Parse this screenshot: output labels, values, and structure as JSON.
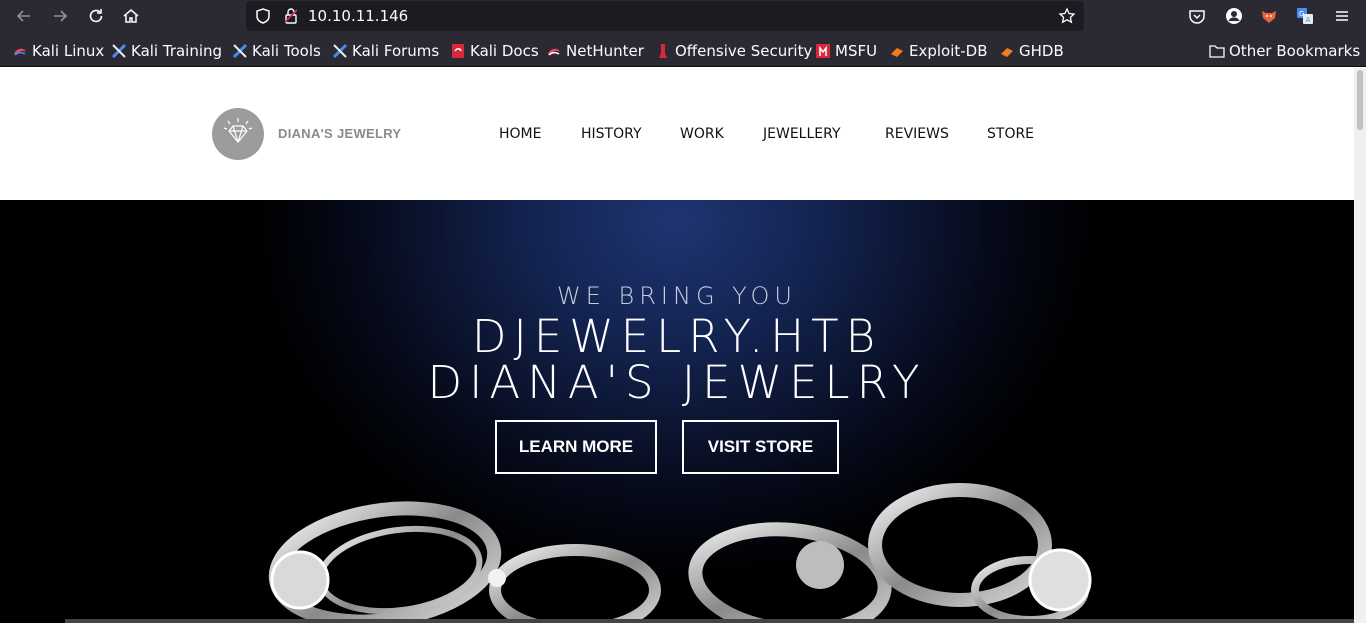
{
  "browser": {
    "url": "10.10.11.146",
    "bookmarks": [
      {
        "label": "Kali Linux",
        "icon": "kali-icon"
      },
      {
        "label": "Kali Training",
        "icon": "kali-training-icon"
      },
      {
        "label": "Kali Tools",
        "icon": "kali-tools-icon"
      },
      {
        "label": "Kali Forums",
        "icon": "kali-forums-icon"
      },
      {
        "label": "Kali Docs",
        "icon": "kali-docs-icon"
      },
      {
        "label": "NetHunter",
        "icon": "nethunter-icon"
      },
      {
        "label": "Offensive Security",
        "icon": "offsec-icon"
      },
      {
        "label": "MSFU",
        "icon": "msfu-icon"
      },
      {
        "label": "Exploit-DB",
        "icon": "exploitdb-icon"
      },
      {
        "label": "GHDB",
        "icon": "ghdb-icon"
      }
    ],
    "other_bookmarks": "Other Bookmarks"
  },
  "site": {
    "logo_text": "DIANA'S JEWELRY",
    "menu": [
      "HOME",
      "HISTORY",
      "WORK",
      "JEWELLERY",
      "REVIEWS",
      "STORE"
    ],
    "hero": {
      "subtitle": "WE BRING YOU",
      "title_line1": "DJEWELRY.HTB",
      "title_line2": "DIANA'S JEWELRY",
      "learn_more": "LEARN MORE",
      "visit_store": "VISIT STORE"
    }
  },
  "colors": {
    "chrome": "#2b2a33",
    "urlbar": "#1c1b22",
    "hero_glow": "#1f3572"
  }
}
